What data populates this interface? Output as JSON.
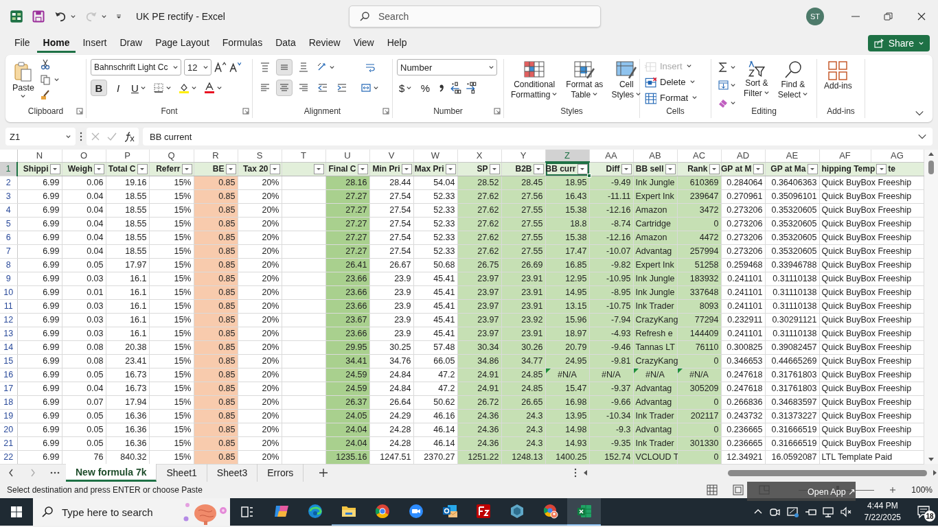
{
  "title_bar": {
    "title": "UK PE rectify  -  Excel",
    "search": {
      "placeholder": "Search"
    },
    "avatar": "ST",
    "redo_disabled": true
  },
  "menu": {
    "tabs": [
      {
        "label": "File",
        "selected": false
      },
      {
        "label": "Home",
        "selected": true
      },
      {
        "label": "Insert",
        "selected": false
      },
      {
        "label": "Draw",
        "selected": false
      },
      {
        "label": "Page Layout",
        "selected": false
      },
      {
        "label": "Formulas",
        "selected": false
      },
      {
        "label": "Data",
        "selected": false
      },
      {
        "label": "Review",
        "selected": false
      },
      {
        "label": "View",
        "selected": false
      },
      {
        "label": "Help",
        "selected": false
      }
    ],
    "share": "Share"
  },
  "ribbon": {
    "groups": [
      {
        "kind": "clipboard",
        "label": "Clipboard",
        "paste": "Paste"
      },
      {
        "kind": "font",
        "label": "Font",
        "font_name": "Bahnschrift Light Cc",
        "font_size": "12",
        "styles": [
          {
            "label": "B",
            "pressed": true
          },
          {
            "label": "I",
            "pressed": false
          },
          {
            "label": "U",
            "pressed": false
          }
        ]
      },
      {
        "kind": "alignment",
        "label": "Alignment",
        "vertical": [
          {
            "pressed": false
          },
          {
            "pressed": true
          },
          {
            "pressed": false
          }
        ],
        "horizontal": [
          {
            "pressed": false
          },
          {
            "pressed": true
          },
          {
            "pressed": false
          }
        ]
      },
      {
        "kind": "number",
        "label": "Number",
        "format": "Number",
        "currency": "$",
        "percent": "%"
      },
      {
        "kind": "styles",
        "label": "Styles",
        "items": [
          {
            "label": "Conditional\nFormatting"
          },
          {
            "label": "Format as\nTable"
          },
          {
            "label": "Cell\nStyles"
          }
        ]
      },
      {
        "kind": "cells",
        "label": "Cells",
        "items": [
          {
            "label": "Insert",
            "disabled": true
          },
          {
            "label": "Delete",
            "disabled": false
          },
          {
            "label": "Format",
            "disabled": false
          }
        ]
      },
      {
        "kind": "editing",
        "label": "Editing",
        "items": [
          {
            "label": "Sort &\nFilter"
          },
          {
            "label": "Find &\nSelect"
          }
        ]
      },
      {
        "kind": "addins",
        "label": "Add-ins",
        "item": "Add-ins"
      }
    ]
  },
  "formula_bar": {
    "name_box": "Z1",
    "value": "BB current"
  },
  "sheet": {
    "columns": [
      {
        "letter": "N",
        "kind": "number",
        "selected": false
      },
      {
        "letter": "O",
        "kind": "number",
        "selected": false
      },
      {
        "letter": "P",
        "kind": "number",
        "selected": false
      },
      {
        "letter": "Q",
        "kind": "number",
        "selected": false
      },
      {
        "letter": "R",
        "kind": "number",
        "selected": false,
        "color": "#f8cbad"
      },
      {
        "letter": "S",
        "kind": "number",
        "selected": false
      },
      {
        "letter": "T",
        "kind": "number",
        "selected": false
      },
      {
        "letter": "U",
        "kind": "number",
        "selected": false,
        "color": "#a9d08e"
      },
      {
        "letter": "V",
        "kind": "number",
        "selected": false
      },
      {
        "letter": "W",
        "kind": "number",
        "selected": false
      },
      {
        "letter": "X",
        "kind": "number",
        "selected": false,
        "color": "#c6e0b4"
      },
      {
        "letter": "Y",
        "kind": "number",
        "selected": false,
        "color": "#c6e0b4"
      },
      {
        "letter": "Z",
        "kind": "number",
        "selected": true,
        "color": "#c6e0b4"
      },
      {
        "letter": "AA",
        "kind": "number",
        "selected": false,
        "color": "#c6e0b4"
      },
      {
        "letter": "AB",
        "kind": "text",
        "selected": false,
        "color": "#c6e0b4"
      },
      {
        "letter": "AC",
        "kind": "number",
        "selected": false,
        "color": "#c6e0b4"
      },
      {
        "letter": "AD",
        "kind": "number",
        "selected": false
      },
      {
        "letter": "AE",
        "kind": "number",
        "selected": false
      },
      {
        "letter": "AF",
        "kind": "text",
        "selected": false
      },
      {
        "letter": "AG",
        "selected": false
      }
    ],
    "header_row": {
      "number": "1",
      "selected": true,
      "cells": [
        {
          "text": "Shippi"
        },
        {
          "text": "Weigh"
        },
        {
          "text": "Total C"
        },
        {
          "text": "Referr"
        },
        {
          "text": "BE"
        },
        {
          "text": "Tax 20"
        },
        {},
        {
          "text": "Final C"
        },
        {
          "text": "Min Pri"
        },
        {
          "text": "Max Pri"
        },
        {
          "text": "SP"
        },
        {
          "text": "B2B"
        },
        {
          "text": "BB curr"
        },
        {
          "text": "Diff"
        },
        {
          "text": "BB sell"
        },
        {
          "text": "Rank"
        },
        {
          "text": "GP at M"
        },
        {
          "text": "GP at Ma"
        },
        {
          "text": "hipping Temp",
          "trailing": "te",
          "colspan": 2
        }
      ]
    },
    "rows": [
      {
        "number": "2",
        "selected": false,
        "cells": [
          "6.99",
          "0.06",
          "19.16",
          "15%",
          "0.85",
          "20%",
          null,
          "28.16",
          "28.44",
          "54.04",
          "28.52",
          "28.45",
          "18.95",
          "-9.49",
          "Ink Jungle",
          "610369",
          "0.284064",
          "0.36406363",
          {
            "kind": "text",
            "text": "Quick BuyBox Freeship",
            "colspan": 2
          }
        ]
      },
      {
        "number": "3",
        "selected": false,
        "cells": [
          "6.99",
          "0.04",
          "18.55",
          "15%",
          "0.85",
          "20%",
          null,
          "27.27",
          "27.54",
          "52.33",
          "27.62",
          "27.56",
          "16.43",
          "-11.11",
          "Expert Ink",
          "239647",
          "0.270961",
          "0.35096101",
          {
            "kind": "text",
            "text": "Quick BuyBox Freeship",
            "colspan": 2
          }
        ]
      },
      {
        "number": "4",
        "selected": false,
        "cells": [
          "6.99",
          "0.04",
          "18.55",
          "15%",
          "0.85",
          "20%",
          null,
          "27.27",
          "27.54",
          "52.33",
          "27.62",
          "27.55",
          "15.38",
          "-12.16",
          "Amazon",
          "3472",
          "0.273206",
          "0.35320605",
          {
            "kind": "text",
            "text": "Quick BuyBox Freeship",
            "colspan": 2
          }
        ]
      },
      {
        "number": "5",
        "selected": false,
        "cells": [
          "6.99",
          "0.04",
          "18.55",
          "15%",
          "0.85",
          "20%",
          null,
          "27.27",
          "27.54",
          "52.33",
          "27.62",
          "27.55",
          "18.8",
          "-8.74",
          "Cartridge",
          "0",
          "0.273206",
          "0.35320605",
          {
            "kind": "text",
            "text": "Quick BuyBox Freeship",
            "colspan": 2
          }
        ]
      },
      {
        "number": "6",
        "selected": false,
        "cells": [
          "6.99",
          "0.04",
          "18.55",
          "15%",
          "0.85",
          "20%",
          null,
          "27.27",
          "27.54",
          "52.33",
          "27.62",
          "27.55",
          "15.38",
          "-12.16",
          "Amazon",
          "4472",
          "0.273206",
          "0.35320605",
          {
            "kind": "text",
            "text": "Quick BuyBox Freeship",
            "colspan": 2
          }
        ]
      },
      {
        "number": "7",
        "selected": false,
        "cells": [
          "6.99",
          "0.04",
          "18.55",
          "15%",
          "0.85",
          "20%",
          null,
          "27.27",
          "27.54",
          "52.33",
          "27.62",
          "27.55",
          "17.47",
          "-10.07",
          "Advantag",
          "257994",
          "0.273206",
          "0.35320605",
          {
            "kind": "text",
            "text": "Quick BuyBox Freeship",
            "colspan": 2
          }
        ]
      },
      {
        "number": "8",
        "selected": false,
        "cells": [
          "6.99",
          "0.05",
          "17.97",
          "15%",
          "0.85",
          "20%",
          null,
          "26.41",
          "26.67",
          "50.68",
          "26.75",
          "26.69",
          "16.85",
          "-9.82",
          "Expert Ink",
          "51258",
          "0.259468",
          "0.33946788",
          {
            "kind": "text",
            "text": "Quick BuyBox Freeship",
            "colspan": 2
          }
        ]
      },
      {
        "number": "9",
        "selected": false,
        "cells": [
          "6.99",
          "0.03",
          "16.1",
          "15%",
          "0.85",
          "20%",
          null,
          "23.66",
          "23.9",
          "45.41",
          "23.97",
          "23.91",
          "12.95",
          "-10.95",
          "Ink Jungle",
          "183932",
          "0.241101",
          "0.31110138",
          {
            "kind": "text",
            "text": "Quick BuyBox Freeship",
            "colspan": 2
          }
        ]
      },
      {
        "number": "10",
        "selected": false,
        "cells": [
          "6.99",
          "0.01",
          "16.1",
          "15%",
          "0.85",
          "20%",
          null,
          "23.66",
          "23.9",
          "45.41",
          "23.97",
          "23.91",
          "14.95",
          "-8.95",
          "Ink Jungle",
          "337648",
          "0.241101",
          "0.31110138",
          {
            "kind": "text",
            "text": "Quick BuyBox Freeship",
            "colspan": 2
          }
        ]
      },
      {
        "number": "11",
        "selected": false,
        "cells": [
          "6.99",
          "0.03",
          "16.1",
          "15%",
          "0.85",
          "20%",
          null,
          "23.66",
          "23.9",
          "45.41",
          "23.97",
          "23.91",
          "13.15",
          "-10.75",
          "Ink Trader",
          "8093",
          "0.241101",
          "0.31110138",
          {
            "kind": "text",
            "text": "Quick BuyBox Freeship",
            "colspan": 2
          }
        ]
      },
      {
        "number": "12",
        "selected": false,
        "cells": [
          "6.99",
          "0.03",
          "16.1",
          "15%",
          "0.85",
          "20%",
          null,
          "23.67",
          "23.9",
          "45.41",
          "23.97",
          "23.92",
          "15.96",
          "-7.94",
          "CrazyKang",
          "77294",
          "0.232911",
          "0.30291121",
          {
            "kind": "text",
            "text": "Quick BuyBox Freeship",
            "colspan": 2
          }
        ]
      },
      {
        "number": "13",
        "selected": false,
        "cells": [
          "6.99",
          "0.03",
          "16.1",
          "15%",
          "0.85",
          "20%",
          null,
          "23.66",
          "23.9",
          "45.41",
          "23.97",
          "23.91",
          "18.97",
          "-4.93",
          "Refresh e",
          "144409",
          "0.241101",
          "0.31110138",
          {
            "kind": "text",
            "text": "Quick BuyBox Freeship",
            "colspan": 2
          }
        ]
      },
      {
        "number": "14",
        "selected": false,
        "cells": [
          "6.99",
          "0.08",
          "20.38",
          "15%",
          "0.85",
          "20%",
          null,
          "29.95",
          "30.25",
          "57.48",
          "30.34",
          "30.26",
          "20.79",
          "-9.46",
          "Tannas LT",
          "76110",
          "0.300825",
          "0.39082457",
          {
            "kind": "text",
            "text": "Quick BuyBox Freeship",
            "colspan": 2
          }
        ]
      },
      {
        "number": "15",
        "selected": false,
        "cells": [
          "6.99",
          "0.08",
          "23.41",
          "15%",
          "0.85",
          "20%",
          null,
          "34.41",
          "34.76",
          "66.05",
          "34.86",
          "34.77",
          "24.95",
          "-9.81",
          "CrazyKang",
          "0",
          "0.346653",
          "0.44665269",
          {
            "kind": "text",
            "text": "Quick BuyBox Freeship",
            "colspan": 2
          }
        ]
      },
      {
        "number": "16",
        "selected": false,
        "cells": [
          "6.99",
          "0.05",
          "16.73",
          "15%",
          "0.85",
          "20%",
          null,
          "24.59",
          "24.84",
          "47.2",
          "24.91",
          "24.85",
          {
            "kind": "error",
            "text": "#N/A",
            "flagged": true
          },
          {
            "kind": "error",
            "text": "#N/A",
            "flagged": false
          },
          {
            "kind": "error",
            "text": "#N/A",
            "flagged": true
          },
          {
            "kind": "error",
            "text": "#N/A",
            "flagged": true
          },
          "0.247618",
          "0.31761803",
          {
            "kind": "text",
            "text": "Quick BuyBox Freeship",
            "colspan": 2
          }
        ]
      },
      {
        "number": "17",
        "selected": false,
        "cells": [
          "6.99",
          "0.04",
          "16.73",
          "15%",
          "0.85",
          "20%",
          null,
          "24.59",
          "24.84",
          "47.2",
          "24.91",
          "24.85",
          "15.47",
          "-9.37",
          "Advantag",
          "305209",
          "0.247618",
          "0.31761803",
          {
            "kind": "text",
            "text": "Quick BuyBox Freeship",
            "colspan": 2
          }
        ]
      },
      {
        "number": "18",
        "selected": false,
        "cells": [
          "6.99",
          "0.07",
          "17.94",
          "15%",
          "0.85",
          "20%",
          null,
          "26.37",
          "26.64",
          "50.62",
          "26.72",
          "26.65",
          "16.98",
          "-9.66",
          "Advantag",
          "0",
          "0.266836",
          "0.34683597",
          {
            "kind": "text",
            "text": "Quick BuyBox Freeship",
            "colspan": 2
          }
        ]
      },
      {
        "number": "19",
        "selected": false,
        "cells": [
          "6.99",
          "0.05",
          "16.36",
          "15%",
          "0.85",
          "20%",
          null,
          "24.05",
          "24.29",
          "46.16",
          "24.36",
          "24.3",
          "13.95",
          "-10.34",
          "Ink Trader",
          "202117",
          "0.243732",
          "0.31373227",
          {
            "kind": "text",
            "text": "Quick BuyBox Freeship",
            "colspan": 2
          }
        ]
      },
      {
        "number": "20",
        "selected": false,
        "cells": [
          "6.99",
          "0.05",
          "16.36",
          "15%",
          "0.85",
          "20%",
          null,
          "24.04",
          "24.28",
          "46.14",
          "24.36",
          "24.3",
          "14.98",
          "-9.3",
          "Advantag",
          "0",
          "0.236665",
          "0.31666519",
          {
            "kind": "text",
            "text": "Quick BuyBox Freeship",
            "colspan": 2
          }
        ]
      },
      {
        "number": "21",
        "selected": false,
        "cells": [
          "6.99",
          "0.05",
          "16.36",
          "15%",
          "0.85",
          "20%",
          null,
          "24.04",
          "24.28",
          "46.14",
          "24.36",
          "24.3",
          "14.93",
          "-9.35",
          "Ink Trader",
          "301330",
          "0.236665",
          "0.31666519",
          {
            "kind": "text",
            "text": "Quick BuyBox Freeship",
            "colspan": 2
          }
        ]
      },
      {
        "number": "22",
        "selected": false,
        "cells": [
          "6.99",
          "76",
          "840.32",
          "15%",
          "0.85",
          "20%",
          null,
          "1235.16",
          "1247.51",
          "2370.27",
          "1251.22",
          "1248.13",
          "1400.25",
          "152.74",
          "VCLOUD T",
          "0",
          "12.34921",
          "16.0592087",
          {
            "kind": "text",
            "text": "LTL Template Paid",
            "colspan": 2
          }
        ]
      }
    ]
  },
  "sheet_tabs": [
    {
      "label": "New formula 7k",
      "selected": true
    },
    {
      "label": "Sheet1",
      "selected": false
    },
    {
      "label": "Sheet3",
      "selected": false
    },
    {
      "label": "Errors",
      "selected": false
    }
  ],
  "status_bar": {
    "message": "Select destination and press ENTER or choose Paste",
    "overlay": "Open App ↗",
    "zoom": {
      "level": 0.5
    },
    "zoom_label": "100%"
  },
  "taskbar": {
    "search": {
      "placeholder": "Type here to search"
    },
    "apps": [
      {
        "running": false,
        "active": false
      },
      {
        "running": false,
        "active": false
      },
      {
        "running": true,
        "active": false
      },
      {
        "running": true,
        "active": false
      },
      {
        "running": true,
        "active": false
      },
      {
        "running": true,
        "active": false
      },
      {
        "running": true,
        "active": false
      },
      {
        "running": true,
        "active": false
      },
      {
        "running": true,
        "active": false
      },
      {
        "running": true,
        "active": true
      }
    ],
    "time": "4:44 PM",
    "date": "7/22/2025",
    "notifications": "18"
  }
}
